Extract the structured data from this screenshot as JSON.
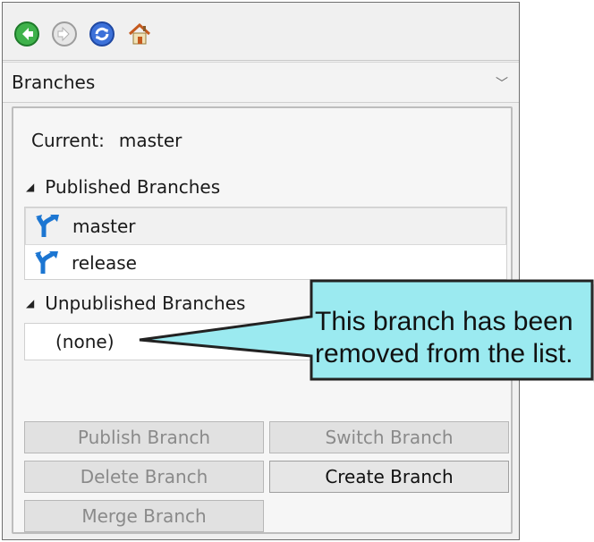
{
  "toolbar": {
    "icons": [
      "back-icon",
      "forward-icon",
      "refresh-icon",
      "home-icon"
    ]
  },
  "dropdown": {
    "label": "Branches"
  },
  "current": {
    "label": "Current:",
    "value": "master"
  },
  "published": {
    "header": "Published Branches",
    "items": [
      {
        "label": "master",
        "selected": true
      },
      {
        "label": "release",
        "selected": false
      }
    ]
  },
  "unpublished": {
    "header": "Unpublished Branches",
    "items": [
      {
        "label": "(none)"
      }
    ]
  },
  "buttons": {
    "publish": "Publish Branch",
    "switch": "Switch Branch",
    "delete": "Delete Branch",
    "create": "Create Branch",
    "merge": "Merge Branch"
  },
  "callout": {
    "line1": "This branch has been",
    "line2": "removed from the list.",
    "fill": "#9beaf0",
    "stroke": "#222222"
  }
}
